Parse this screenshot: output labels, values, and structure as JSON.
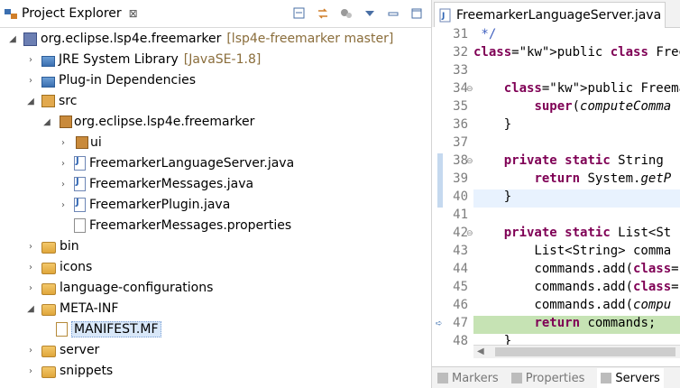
{
  "explorer": {
    "title": "Project Explorer",
    "close": "⊠",
    "tree": [
      {
        "label": "org.eclipse.lsp4e.freemarker",
        "decor": "[lsp4e-freemarker master]",
        "icon": "project-icon",
        "indent": 0,
        "expanded": true
      },
      {
        "label": "JRE System Library",
        "decor": "[JavaSE-1.8]",
        "icon": "library-icon",
        "indent": 1,
        "expanded": false
      },
      {
        "label": "Plug-in Dependencies",
        "decor": "",
        "icon": "library-icon",
        "indent": 1,
        "expanded": false
      },
      {
        "label": "src",
        "decor": "",
        "icon": "source-folder-icon",
        "indent": 1,
        "expanded": true
      },
      {
        "label": "org.eclipse.lsp4e.freemarker",
        "decor": "",
        "icon": "package-icon",
        "indent": 2,
        "expanded": true
      },
      {
        "label": "ui",
        "decor": "",
        "icon": "package-icon",
        "indent": 3,
        "expanded": false
      },
      {
        "label": "FreemarkerLanguageServer.java",
        "decor": "",
        "icon": "java-file-icon",
        "indent": 3,
        "expanded": false
      },
      {
        "label": "FreemarkerMessages.java",
        "decor": "",
        "icon": "java-file-icon",
        "indent": 3,
        "expanded": false
      },
      {
        "label": "FreemarkerPlugin.java",
        "decor": "",
        "icon": "java-file-icon",
        "indent": 3,
        "expanded": false
      },
      {
        "label": "FreemarkerMessages.properties",
        "decor": "",
        "icon": "properties-file-icon",
        "indent": 3,
        "expanded": null
      },
      {
        "label": "bin",
        "decor": "",
        "icon": "folder-icon",
        "indent": 1,
        "expanded": false
      },
      {
        "label": "icons",
        "decor": "",
        "icon": "folder-icon",
        "indent": 1,
        "expanded": false
      },
      {
        "label": "language-configurations",
        "decor": "",
        "icon": "folder-icon",
        "indent": 1,
        "expanded": false
      },
      {
        "label": "META-INF",
        "decor": "",
        "icon": "folder-icon",
        "indent": 1,
        "expanded": true
      },
      {
        "label": "MANIFEST.MF",
        "decor": "",
        "icon": "manifest-file-icon",
        "indent": 2,
        "expanded": null,
        "selected": true
      },
      {
        "label": "server",
        "decor": "",
        "icon": "folder-icon",
        "indent": 1,
        "expanded": false
      },
      {
        "label": "snippets",
        "decor": "",
        "icon": "folder-icon",
        "indent": 1,
        "expanded": false
      }
    ]
  },
  "editor": {
    "tab_title": "FreemarkerLanguageServer.java",
    "lines": [
      {
        "n": "31",
        "text": " */",
        "cls": "cm"
      },
      {
        "n": "32",
        "text": "public class FreemarkerLa",
        "cls": "decl"
      },
      {
        "n": "33",
        "text": "",
        "cls": ""
      },
      {
        "n": "34",
        "text": "    public FreemarkerLangu",
        "cls": "ctor",
        "fold": true
      },
      {
        "n": "35",
        "text": "        super(computeComma",
        "cls": "super"
      },
      {
        "n": "36",
        "text": "    }",
        "cls": ""
      },
      {
        "n": "37",
        "text": "",
        "cls": ""
      },
      {
        "n": "38",
        "text": "    private static String ",
        "cls": "ps",
        "fold": true
      },
      {
        "n": "39",
        "text": "        return System.getP",
        "cls": "ret"
      },
      {
        "n": "40",
        "text": "    }",
        "cls": "",
        "current": true
      },
      {
        "n": "41",
        "text": "",
        "cls": ""
      },
      {
        "n": "42",
        "text": "    private static List<St",
        "cls": "ps",
        "fold": true
      },
      {
        "n": "43",
        "text": "        List<String> comma",
        "cls": ""
      },
      {
        "n": "44",
        "text": "        commands.add(\"java",
        "cls": "addstr"
      },
      {
        "n": "45",
        "text": "        commands.add(\"-jar",
        "cls": "addstr"
      },
      {
        "n": "46",
        "text": "        commands.add(compu",
        "cls": "additalic"
      },
      {
        "n": "47",
        "text": "        return commands;",
        "cls": "ret2",
        "debug": true
      },
      {
        "n": "48",
        "text": "    }",
        "cls": ""
      }
    ]
  },
  "bottom_tabs": [
    {
      "label": "Markers",
      "active": false
    },
    {
      "label": "Properties",
      "active": false
    },
    {
      "label": "Servers",
      "active": true
    }
  ]
}
